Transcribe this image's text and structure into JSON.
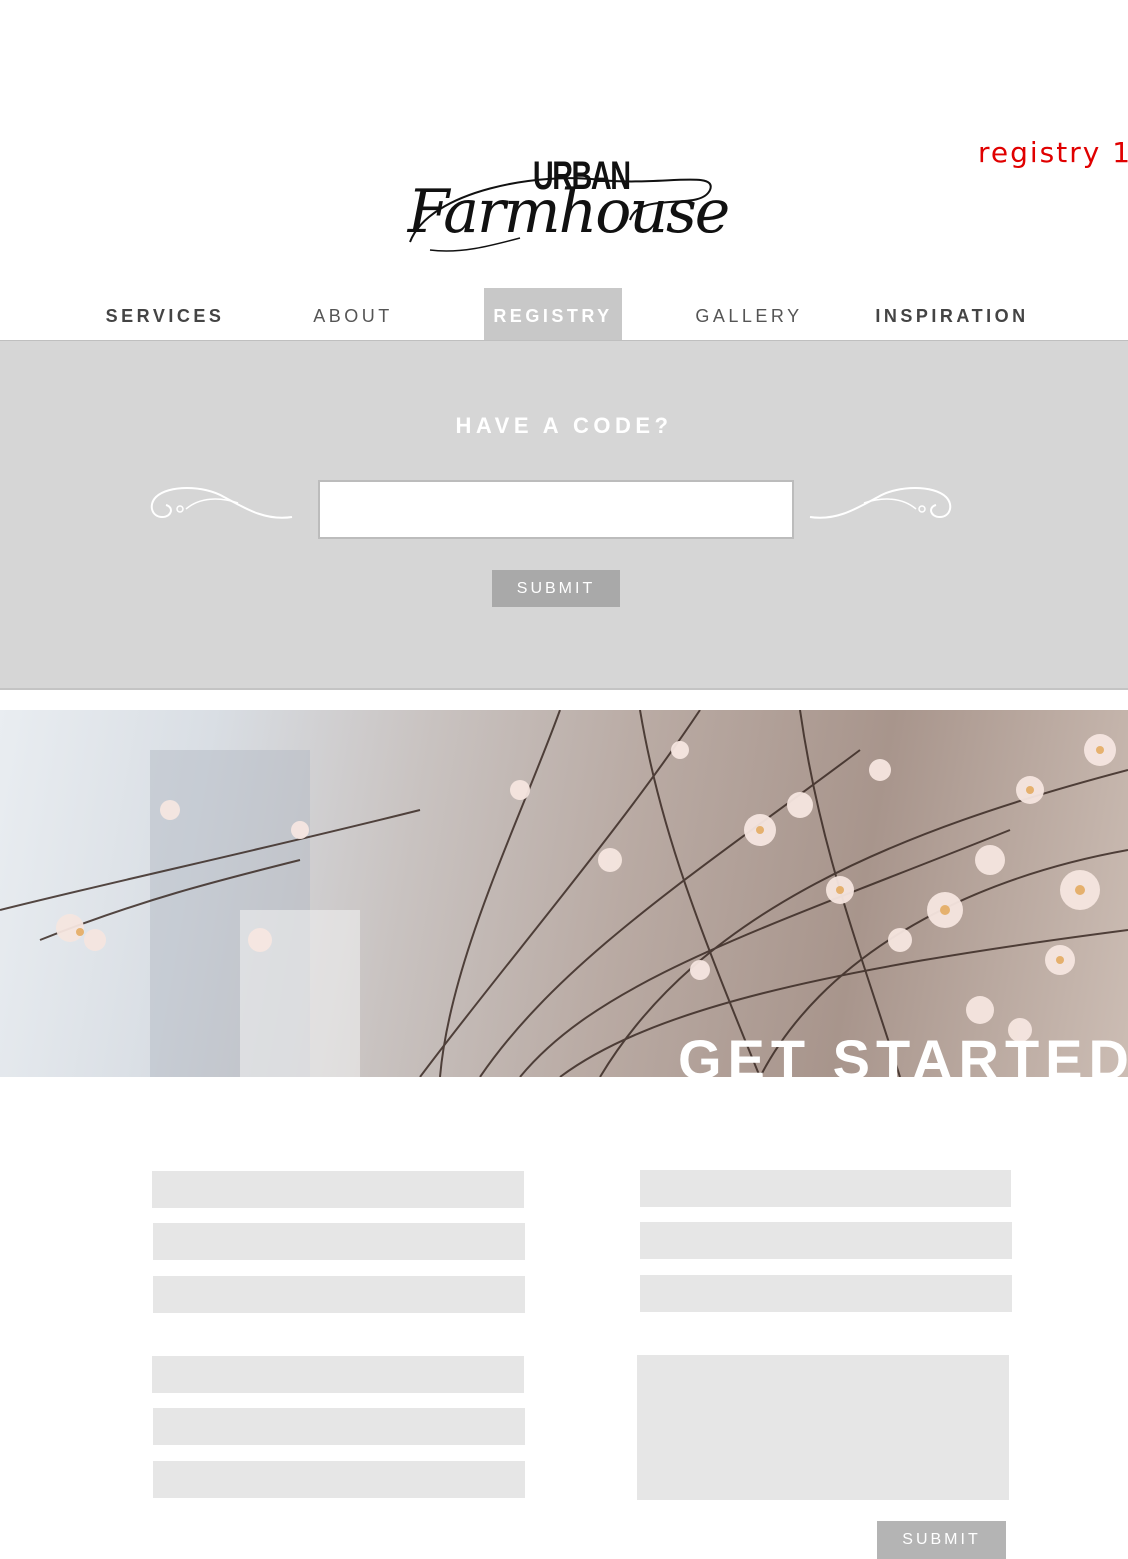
{
  "annotation": "registry 1",
  "logo": {
    "line1": "URBAN",
    "line2": "Farmhouse"
  },
  "nav": {
    "items": [
      {
        "label": "SERVICES"
      },
      {
        "label": "ABOUT"
      },
      {
        "label": "REGISTRY"
      },
      {
        "label": "GALLERY"
      },
      {
        "label": "INSPIRATION"
      }
    ],
    "active": "REGISTRY"
  },
  "code_panel": {
    "title": "HAVE A CODE?",
    "input_value": "",
    "submit_label": "SUBMIT"
  },
  "hero": {
    "title": "GET STARTED"
  },
  "form": {
    "fields_left_top": [
      "",
      "",
      ""
    ],
    "fields_left_bottom": [
      "",
      "",
      ""
    ],
    "fields_right": [
      "",
      "",
      ""
    ],
    "message_value": "",
    "submit_label": "SUBMIT"
  },
  "colors": {
    "annotation": "#e00000",
    "panel_bg": "#d6d6d6",
    "nav_active_bg": "#c8c8c8",
    "field_bg": "#e6e6e6",
    "button_bg": "#a9a9a9"
  }
}
